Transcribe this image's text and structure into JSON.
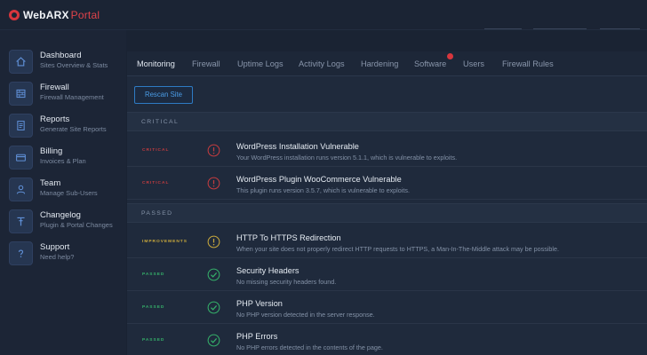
{
  "app": {
    "name": "WebARX",
    "suffix": "Portal"
  },
  "sidebar": {
    "items": [
      {
        "title": "Dashboard",
        "subtitle": "Sites Overview & Stats",
        "icon": "home-icon"
      },
      {
        "title": "Firewall",
        "subtitle": "Firewall Management",
        "icon": "firewall-icon"
      },
      {
        "title": "Reports",
        "subtitle": "Generate Site Reports",
        "icon": "report-icon"
      },
      {
        "title": "Billing",
        "subtitle": "Invoices & Plan",
        "icon": "credit-card-icon"
      },
      {
        "title": "Team",
        "subtitle": "Manage Sub-Users",
        "icon": "user-icon"
      },
      {
        "title": "Changelog",
        "subtitle": "Plugin & Portal Changes",
        "icon": "changelog-icon"
      },
      {
        "title": "Support",
        "subtitle": "Need help?",
        "icon": "question-icon"
      }
    ]
  },
  "tabs": [
    {
      "label": "Monitoring",
      "active": true
    },
    {
      "label": "Firewall"
    },
    {
      "label": "Uptime Logs"
    },
    {
      "label": "Activity Logs"
    },
    {
      "label": "Hardening"
    },
    {
      "label": "Software",
      "has_notification": true
    },
    {
      "label": "Users"
    },
    {
      "label": "Firewall Rules"
    }
  ],
  "rescan_label": "Rescan Site",
  "sections": {
    "critical": {
      "heading": "CRITICAL",
      "rows": [
        {
          "status": "CRITICAL",
          "title": "WordPress Installation Vulnerable",
          "description": "Your WordPress installation runs version 5.1.1, which is vulnerable to exploits."
        },
        {
          "status": "CRITICAL",
          "title": "WordPress Plugin WooCommerce Vulnerable",
          "description": "This plugin runs version 3.5.7, which is vulnerable to exploits."
        }
      ]
    },
    "passed": {
      "heading": "PASSED",
      "rows": [
        {
          "status": "IMPROVEMENTS",
          "title": "HTTP To HTTPS Redirection",
          "description": "When your site does not properly redirect HTTP requests to HTTPS, a Man-In-The-Middle attack may be possible."
        },
        {
          "status": "PASSED",
          "title": "Security Headers",
          "description": "No missing security headers found."
        },
        {
          "status": "PASSED",
          "title": "PHP Version",
          "description": "No PHP version detected in the server response."
        },
        {
          "status": "PASSED",
          "title": "PHP Errors",
          "description": "No PHP errors detected in the contents of the page."
        }
      ]
    }
  },
  "colors": {
    "critical": "#c43c3f",
    "improvements": "#c9a93c",
    "passed": "#35b06a",
    "accent": "#2e7bc4"
  }
}
